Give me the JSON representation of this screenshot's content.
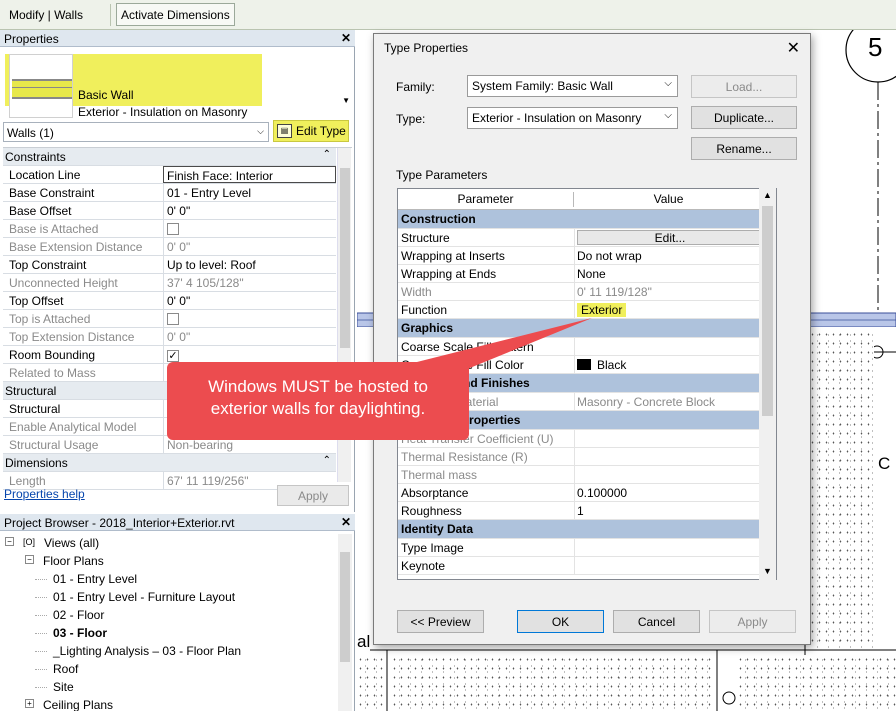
{
  "ribbon": {
    "context_label": "Modify | Walls",
    "button_label": "Activate Dimensions"
  },
  "properties": {
    "title": "Properties",
    "family_name": "Basic Wall",
    "type_name": "Exterior - Insulation on Masonry",
    "instance_filter": "Walls (1)",
    "edit_type_label": "Edit Type",
    "help_label": "Properties help",
    "apply_label": "Apply",
    "rows": [
      {
        "cat": true,
        "k": "Constraints"
      },
      {
        "k": "Location Line",
        "v": "Finish Face: Interior",
        "boxed": true
      },
      {
        "k": "Base Constraint",
        "v": "01 - Entry Level"
      },
      {
        "k": "Base Offset",
        "v": "0'  0\""
      },
      {
        "k": "Base is Attached",
        "cb": "",
        "dis": true
      },
      {
        "k": "Base Extension Distance",
        "v": "0'  0\"",
        "dis": true
      },
      {
        "k": "Top Constraint",
        "v": "Up to level: Roof"
      },
      {
        "k": "Unconnected Height",
        "v": "37'  4 105/128\"",
        "dis": true
      },
      {
        "k": "Top Offset",
        "v": "0'  0\""
      },
      {
        "k": "Top is Attached",
        "cb": "",
        "dis": true
      },
      {
        "k": "Top Extension Distance",
        "v": "0'  0\"",
        "dis": true
      },
      {
        "k": "Room Bounding",
        "cb": "✓"
      },
      {
        "k": "Related to Mass",
        "v": "",
        "dis": true
      },
      {
        "cat": true,
        "k": "Structural"
      },
      {
        "k": "Structural",
        "cb": ""
      },
      {
        "k": "Enable Analytical Model",
        "v": "",
        "dis": true
      },
      {
        "k": "Structural Usage",
        "v": "Non-bearing",
        "dis": true
      },
      {
        "cat": true,
        "k": "Dimensions"
      },
      {
        "k": "Length",
        "v": "67'  11 119/256\"",
        "dis": true
      }
    ]
  },
  "browser": {
    "title": "Project Browser - 2018_Interior+Exterior.rvt",
    "nodes": [
      {
        "label": "Views (all)",
        "level": 0,
        "exp": "−",
        "icon": true
      },
      {
        "label": "Floor Plans",
        "level": 1,
        "exp": "−"
      },
      {
        "label": "01 - Entry Level",
        "level": 2
      },
      {
        "label": "01 - Entry Level - Furniture Layout",
        "level": 2
      },
      {
        "label": "02 - Floor",
        "level": 2
      },
      {
        "label": "03 - Floor",
        "level": 2,
        "bold": true
      },
      {
        "label": "_Lighting Analysis – 03 - Floor Plan",
        "level": 2
      },
      {
        "label": "Roof",
        "level": 2
      },
      {
        "label": "Site",
        "level": 2
      },
      {
        "label": "Ceiling Plans",
        "level": 1,
        "exp": "+"
      }
    ]
  },
  "drawing": {
    "grid_bubble": "5",
    "text_c": "C",
    "text_al": "al"
  },
  "dialog": {
    "title": "Type Properties",
    "family_label": "Family:",
    "family_value": "System Family: Basic Wall",
    "type_label": "Type:",
    "type_value": "Exterior - Insulation on Masonry",
    "load_label": "Load...",
    "duplicate_label": "Duplicate...",
    "rename_label": "Rename...",
    "section_label": "Type Parameters",
    "col_parameter": "Parameter",
    "col_value": "Value",
    "col_sort": "=",
    "rows": [
      {
        "cat": true,
        "k": "Construction"
      },
      {
        "k": "Structure",
        "btn": "Edit..."
      },
      {
        "k": "Wrapping at Inserts",
        "v": "Do not wrap"
      },
      {
        "k": "Wrapping at Ends",
        "v": "None"
      },
      {
        "k": "Width",
        "v": "0'  11 119/128\"",
        "dis": true
      },
      {
        "k": "Function",
        "v": "Exterior",
        "hl": true
      },
      {
        "cat": true,
        "k": "Graphics"
      },
      {
        "k": "Coarse Scale Fill Pattern",
        "v": ""
      },
      {
        "k": "Coarse Scale Fill Color",
        "v": "Black",
        "swatch": true
      },
      {
        "cat": true,
        "k": "Materials and Finishes"
      },
      {
        "k": "Structural Material",
        "v": "Masonry - Concrete Block",
        "dis": true
      },
      {
        "cat": true,
        "k": "Analytical Properties"
      },
      {
        "k": "Heat Transfer Coefficient (U)",
        "v": "",
        "dis": true
      },
      {
        "k": "Thermal Resistance (R)",
        "v": "",
        "dis": true
      },
      {
        "k": "Thermal mass",
        "v": "",
        "dis": true
      },
      {
        "k": "Absorptance",
        "v": "0.100000"
      },
      {
        "k": "Roughness",
        "v": "1"
      },
      {
        "cat": true,
        "k": "Identity Data"
      },
      {
        "k": "Type Image",
        "v": ""
      },
      {
        "k": "Keynote",
        "v": ""
      }
    ],
    "preview_label": "<< Preview",
    "ok_label": "OK",
    "cancel_label": "Cancel",
    "apply_label": "Apply"
  },
  "callout": {
    "line1": "Windows MUST be hosted to",
    "line2": "exterior walls for daylighting."
  }
}
